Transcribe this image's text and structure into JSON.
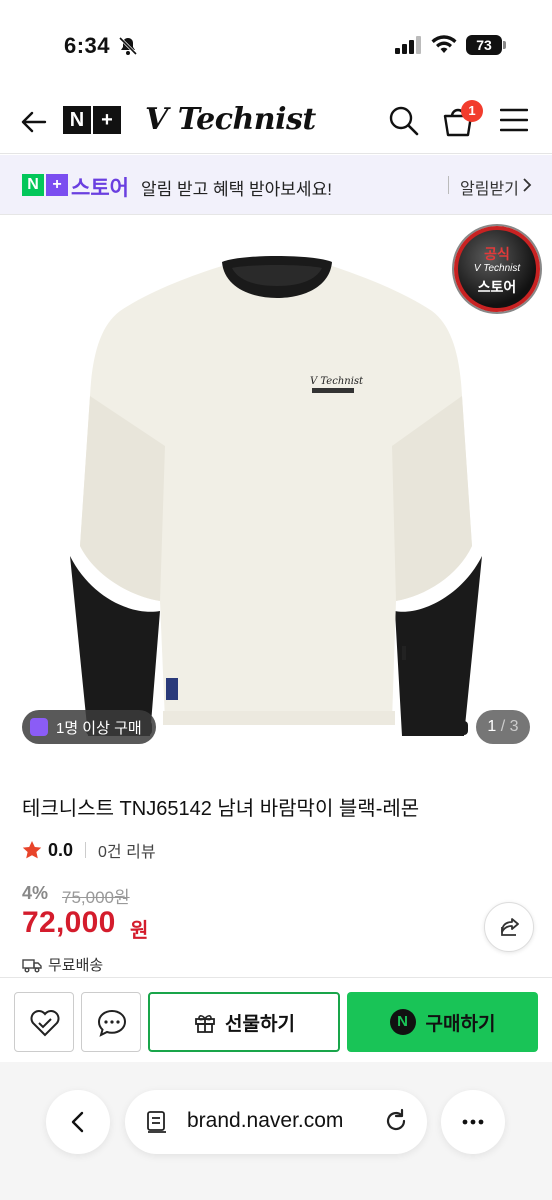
{
  "status_bar": {
    "time": "6:34",
    "battery": "73"
  },
  "header": {
    "brand_mark_1": "N",
    "brand_mark_2": "+",
    "brand_name": "V Technist",
    "cart_count": "1"
  },
  "banner": {
    "logo_1": "N",
    "logo_2": "+",
    "store_label": "스토어",
    "message": "알림 받고 혜택 받아보세요!",
    "cta": "알림받기"
  },
  "gallery": {
    "official_badge": {
      "line1": "공식",
      "line2": "V Technist",
      "line3": "스토어"
    },
    "buy_chip": "1명 이상 구매",
    "current_index": "1",
    "total": "3",
    "chest_logo": "V Technist"
  },
  "product": {
    "title": "테크니스트 TNJ65142 남녀 바람막이 블랙-레몬",
    "rating": "0.0",
    "reviews": "0건 리뷰",
    "discount": "4%",
    "original_price": "75,000원",
    "price": "72,000",
    "currency": "원",
    "shipping": "무료배송"
  },
  "actions": {
    "gift": "선물하기",
    "buy": "구매하기",
    "buy_icon": "N"
  },
  "browser": {
    "url": "brand.naver.com"
  },
  "colors": {
    "accent_green": "#19c457",
    "price_red": "#d41c2c",
    "store_purple": "#6a3fe0"
  }
}
